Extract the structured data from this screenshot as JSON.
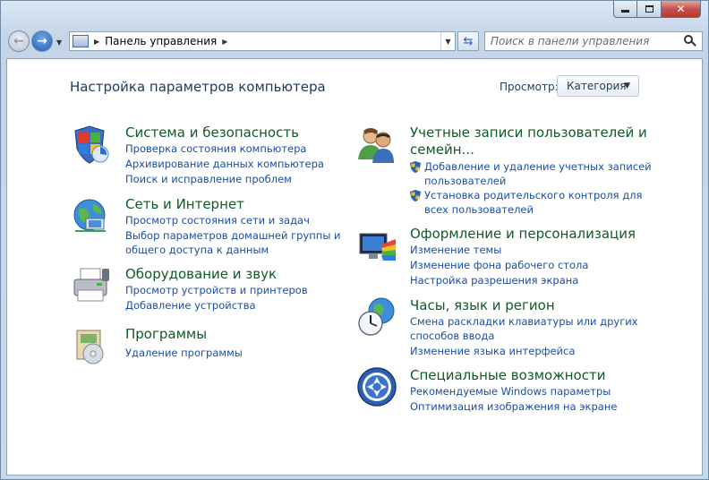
{
  "window": {
    "controls": [
      "minimize",
      "maximize",
      "close"
    ],
    "close_glyph": "✕"
  },
  "nav": {
    "back_glyph": "←",
    "forward_glyph": "→",
    "address_path": "Панель управления",
    "search_placeholder": "Поиск в панели управления"
  },
  "content": {
    "title": "Настройка параметров компьютера",
    "view_label": "Просмотр:",
    "view_value": "Категория"
  },
  "left_categories": [
    {
      "title": "Система и безопасность",
      "icon": "shield-flag-icon",
      "links": [
        "Проверка состояния компьютера",
        "Архивирование данных компьютера",
        "Поиск и исправление проблем"
      ]
    },
    {
      "title": "Сеть и Интернет",
      "icon": "globe-network-icon",
      "links": [
        "Просмотр состояния сети и задач",
        "Выбор параметров домашней группы и",
        "общего доступа к данным"
      ]
    },
    {
      "title": "Оборудование и звук",
      "icon": "printer-icon",
      "links": [
        "Просмотр устройств и принтеров",
        "Добавление устройства"
      ]
    },
    {
      "title": "Программы",
      "icon": "programs-icon",
      "links": [
        "Удаление программы"
      ]
    }
  ],
  "right_categories": [
    {
      "title_line1": "Учетные записи пользователей и",
      "title_line2": "семейн...",
      "icon": "users-icon",
      "links": [
        "Добавление и удаление учетных записей",
        "пользователей",
        "Установка родительского контроля для",
        "всех пользователей"
      ]
    },
    {
      "title": "Оформление и персонализация",
      "icon": "monitor-palette-icon",
      "links": [
        "Изменение темы",
        "Изменение фона рабочего стола",
        "Настройка разрешения экрана"
      ]
    },
    {
      "title": "Часы, язык и регион",
      "icon": "clock-globe-icon",
      "links": [
        "Смена раскладки клавиатуры или других",
        "способов ввода",
        "Изменение языка интерфейса"
      ]
    },
    {
      "title": "Специальные возможности",
      "icon": "accessibility-icon",
      "links": [
        "Рекомендуемые Windows параметры",
        "Оптимизация изображения на экране"
      ]
    }
  ],
  "colors": {
    "title_green": "#0f5a26",
    "link_blue": "#1a4ea3",
    "heading_navy": "#1e3a5f"
  }
}
